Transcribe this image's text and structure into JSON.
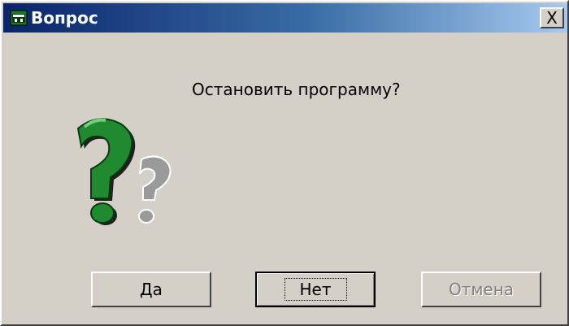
{
  "window": {
    "title": "Вопрос",
    "close_symbol": "X"
  },
  "message": "Остановить программу?",
  "icons": {
    "title_icon": "app-window-icon",
    "dialog_icon": "question-mark-icon"
  },
  "buttons": {
    "yes": "Да",
    "no": "Нет",
    "cancel": "Отмена"
  },
  "button_states": {
    "cancel_enabled": false,
    "focused": "no"
  },
  "colors": {
    "title_gradient_start": "#0a246a",
    "title_gradient_end": "#a6caf0",
    "dialog_background": "#d4d0c8",
    "icon_green": "#1f8a2f",
    "icon_gray": "#9a9a9a"
  }
}
